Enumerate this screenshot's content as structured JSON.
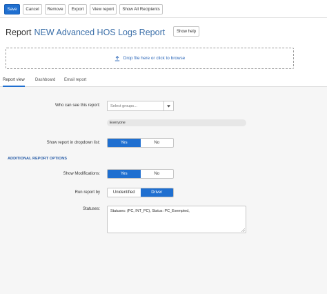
{
  "toolbar": {
    "save": "Save",
    "cancel": "Cancel",
    "remove": "Remove",
    "export": "Export",
    "view_report": "View report",
    "show_all_recipients": "Show All Recipients"
  },
  "header": {
    "title_prefix": "Report",
    "report_name": "NEW Advanced HOS Logs Report",
    "show_help": "Show help"
  },
  "dropzone": {
    "text": "Drop file here or click to browse"
  },
  "tabs": {
    "report_view": "Report view",
    "dashboard": "Dashboard",
    "email_report": "Email report",
    "active": "report_view"
  },
  "form": {
    "who_can_see": {
      "label": "Who can see this report:",
      "placeholder": "Select groups...",
      "selected_chip": "Everyone"
    },
    "show_in_dropdown": {
      "label": "Show report in dropdown list:",
      "yes": "Yes",
      "no": "No",
      "selected": "yes"
    },
    "section_title": "ADDITIONAL REPORT OPTIONS",
    "show_modifications": {
      "label": "Show Modifications:",
      "yes": "Yes",
      "no": "No",
      "selected": "yes"
    },
    "run_report_by": {
      "label": "Run report by",
      "unidentified": "Unidentified",
      "driver": "Driver",
      "selected": "driver"
    },
    "statuses": {
      "label": "Statuses:",
      "value": "Statuses: (PC, INT_PC), Status: PC_Exempted,"
    }
  },
  "colors": {
    "primary": "#1f6fd0",
    "link": "#2a66b8",
    "section": "#2a5ea8",
    "panel_bg": "#f6f6f6"
  }
}
